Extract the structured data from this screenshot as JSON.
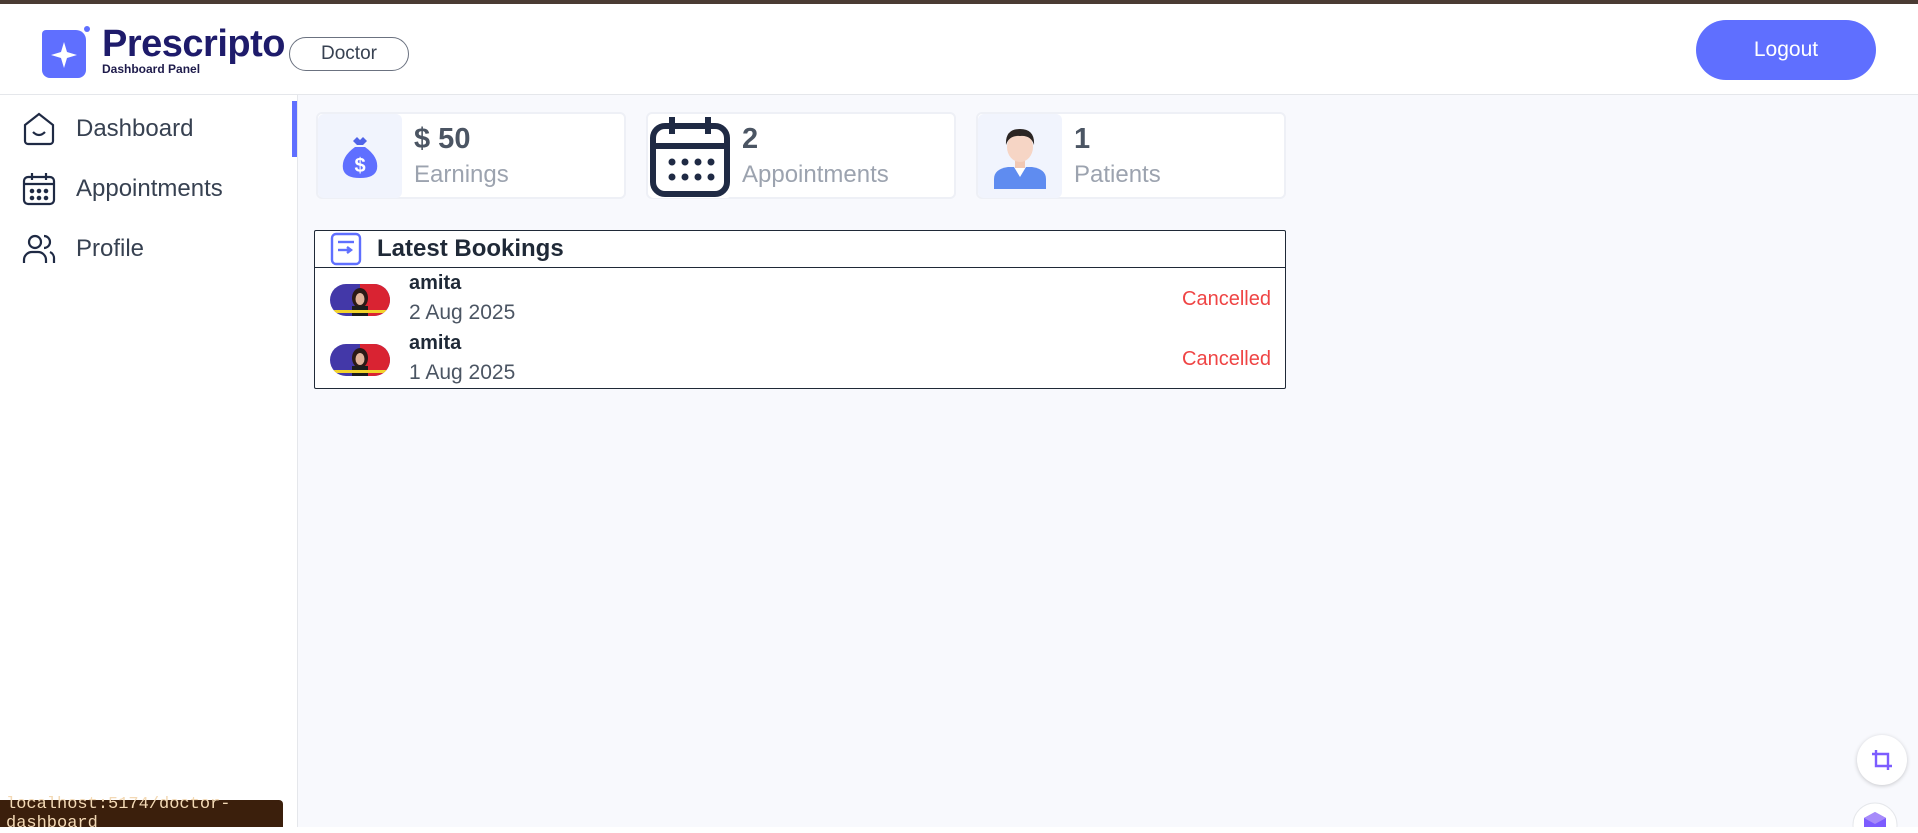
{
  "app": {
    "brand": "Prescripto",
    "brand_sub": "Dashboard Panel",
    "role": "Doctor",
    "logout_label": "Logout",
    "accent": "#5f6fff"
  },
  "sidebar": {
    "items": [
      {
        "label": "Dashboard",
        "icon": "home-icon",
        "active": true
      },
      {
        "label": "Appointments",
        "icon": "calendar-icon"
      },
      {
        "label": "Profile",
        "icon": "users-icon"
      }
    ]
  },
  "stats": {
    "earnings": {
      "value": "$ 50",
      "label": "Earnings",
      "icon": "money-bag-icon"
    },
    "appointments": {
      "value": "2",
      "label": "Appointments",
      "icon": "calendar-icon"
    },
    "patients": {
      "value": "1",
      "label": "Patients",
      "icon": "patient-avatar-icon"
    }
  },
  "bookings": {
    "title": "Latest Bookings",
    "rows": [
      {
        "name": "amita",
        "date": "2 Aug 2025",
        "status": "Cancelled"
      },
      {
        "name": "amita",
        "date": "1 Aug 2025",
        "status": "Cancelled"
      }
    ]
  },
  "statusbar": {
    "url": "localhost:5174/doctor-dashboard"
  }
}
